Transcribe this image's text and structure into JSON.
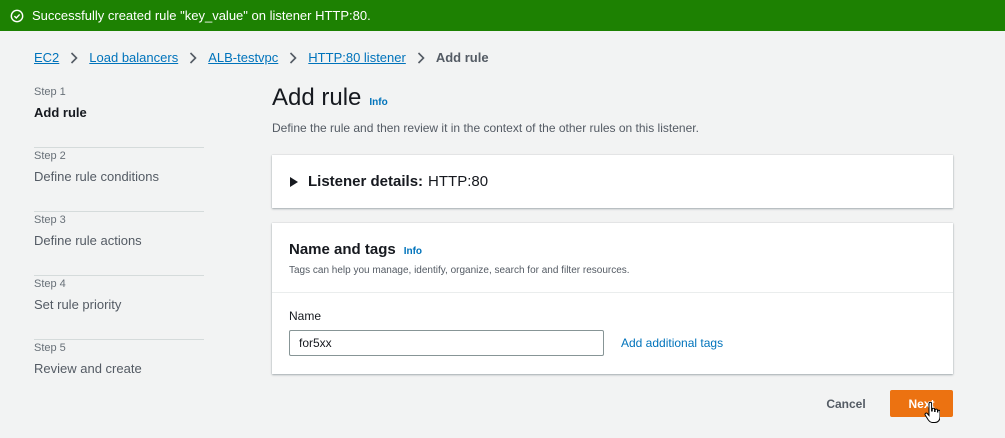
{
  "flash": {
    "message": "Successfully created rule \"key_value\" on listener HTTP:80.",
    "icon": "check-circle-icon",
    "color": "#1d8102"
  },
  "breadcrumb": {
    "items": [
      "EC2",
      "Load balancers",
      "ALB-testvpc",
      "HTTP:80 listener"
    ],
    "current": "Add rule"
  },
  "steps": [
    {
      "num": "Step 1",
      "label": "Add rule"
    },
    {
      "num": "Step 2",
      "label": "Define rule conditions"
    },
    {
      "num": "Step 3",
      "label": "Define rule actions"
    },
    {
      "num": "Step 4",
      "label": "Set rule priority"
    },
    {
      "num": "Step 5",
      "label": "Review and create"
    }
  ],
  "main": {
    "title": "Add rule",
    "info": "Info",
    "description": "Define the rule and then review it in the context of the other rules on this listener."
  },
  "listener": {
    "label": "Listener details:",
    "value": "HTTP:80"
  },
  "tags_panel": {
    "title": "Name and tags",
    "info": "Info",
    "subtitle": "Tags can help you manage, identify, organize, search for and filter resources.",
    "name_label": "Name",
    "name_value": "for5xx",
    "add_tags": "Add additional tags"
  },
  "actions": {
    "cancel": "Cancel",
    "next": "Next",
    "primary_color": "#ec7211"
  }
}
